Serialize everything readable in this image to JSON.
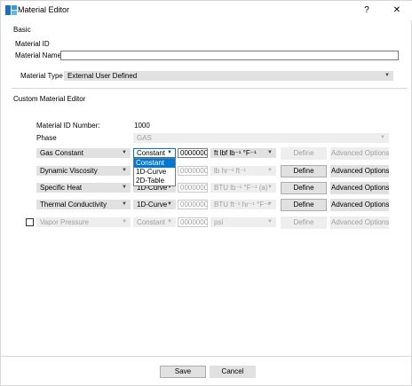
{
  "window": {
    "title": "Material Editor",
    "help": "?",
    "close": "✕"
  },
  "basic": {
    "section_label": "Basic",
    "material_id_label": "Material ID",
    "material_name_label": "Material Name",
    "material_name_value": "",
    "material_type_label": "Material Type",
    "material_type_value": "External User Defined"
  },
  "custom": {
    "section_label": "Custom Material Editor",
    "id_number_label": "Material ID Number:",
    "id_number_value": "1000",
    "phase_label": "Phase",
    "phase_value": "GAS"
  },
  "rows": [
    {
      "property": "Gas Constant",
      "mode": "Constant",
      "value": "0000000",
      "unit": "ft lbf lb⁻¹ °F⁻¹",
      "define": "Define",
      "advanced": "Advanced Options"
    },
    {
      "property": "Dynamic Viscosity",
      "mode": "",
      "value": "0000000",
      "unit": "lb hr⁻¹ ft⁻¹",
      "define": "Define",
      "advanced": "Advanced Options"
    },
    {
      "property": "Specific Heat",
      "mode": "1D-Curve",
      "value": "0000000",
      "unit": "BTU lb⁻¹ °F⁻¹ (a)",
      "define": "Define",
      "advanced": "Advanced Options"
    },
    {
      "property": "Thermal Conductivity",
      "mode": "1D-Curve",
      "value": "0000000",
      "unit": "BTU ft⁻¹ hr⁻¹ °F⁻¹",
      "define": "Define",
      "advanced": "Advanced Options"
    },
    {
      "property": "Vapor Pressure",
      "mode": "Constant",
      "value": "0000000",
      "unit": "psi",
      "define": "Define",
      "advanced": "Advanced Options"
    }
  ],
  "dropdown_options": [
    "Constant",
    "1D-Curve",
    "2D-Table"
  ],
  "footer": {
    "save": "Save",
    "cancel": "Cancel"
  }
}
